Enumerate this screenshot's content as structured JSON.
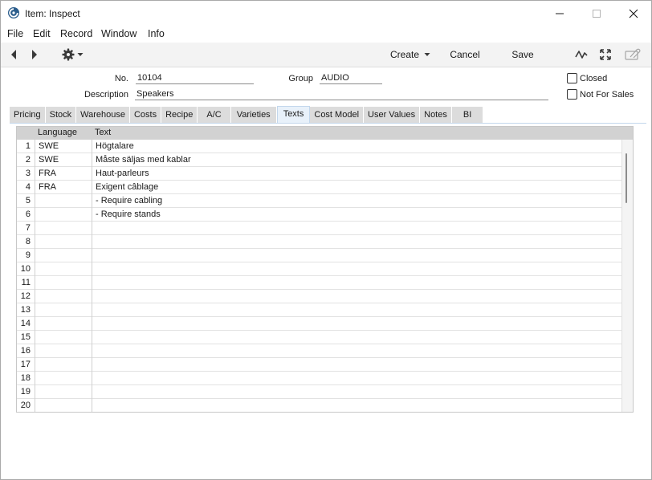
{
  "window": {
    "title": "Item: Inspect",
    "app_icon": "app-logo-icon",
    "controls": [
      "minimize-icon",
      "maximize-icon",
      "close-icon"
    ]
  },
  "menubar": {
    "items": [
      "File",
      "Edit",
      "Record",
      "Window",
      "Info"
    ]
  },
  "toolbar": {
    "create_label": "Create",
    "cancel_label": "Cancel",
    "save_label": "Save",
    "icons": [
      "arrow-left-icon",
      "arrow-right-icon",
      "gear-icon",
      "chevron-down-icon",
      "activity-icon",
      "expand-icon",
      "attachment-icon"
    ]
  },
  "header": {
    "no_label": "No.",
    "no_value": "10104",
    "group_label": "Group",
    "group_value": "AUDIO",
    "description_label": "Description",
    "description_value": "Speakers",
    "closed_label": "Closed",
    "not_for_sales_label": "Not For Sales",
    "closed_checked": false,
    "not_for_sales_checked": false
  },
  "tabs": {
    "items": [
      "Pricing",
      "Stock",
      "Warehouse",
      "Costs",
      "Recipe",
      "A/C",
      "Varieties",
      "Texts",
      "Cost Model",
      "User Values",
      "Notes",
      "BI"
    ],
    "active": "Texts"
  },
  "grid": {
    "columns": [
      "",
      "Language",
      "Text"
    ],
    "rows": [
      {
        "num": "1",
        "language": "SWE",
        "text": "Högtalare"
      },
      {
        "num": "2",
        "language": "SWE",
        "text": "Måste säljas med kablar"
      },
      {
        "num": "3",
        "language": "FRA",
        "text": "Haut-parleurs"
      },
      {
        "num": "4",
        "language": "FRA",
        "text": "Exigent câblage"
      },
      {
        "num": "5",
        "language": "",
        "text": "- Require cabling"
      },
      {
        "num": "6",
        "language": "",
        "text": "- Require stands"
      },
      {
        "num": "7",
        "language": "",
        "text": ""
      },
      {
        "num": "8",
        "language": "",
        "text": ""
      },
      {
        "num": "9",
        "language": "",
        "text": ""
      },
      {
        "num": "10",
        "language": "",
        "text": ""
      },
      {
        "num": "11",
        "language": "",
        "text": ""
      },
      {
        "num": "12",
        "language": "",
        "text": ""
      },
      {
        "num": "13",
        "language": "",
        "text": ""
      },
      {
        "num": "14",
        "language": "",
        "text": ""
      },
      {
        "num": "15",
        "language": "",
        "text": ""
      },
      {
        "num": "16",
        "language": "",
        "text": ""
      },
      {
        "num": "17",
        "language": "",
        "text": ""
      },
      {
        "num": "18",
        "language": "",
        "text": ""
      },
      {
        "num": "19",
        "language": "",
        "text": ""
      },
      {
        "num": "20",
        "language": "",
        "text": ""
      }
    ]
  }
}
